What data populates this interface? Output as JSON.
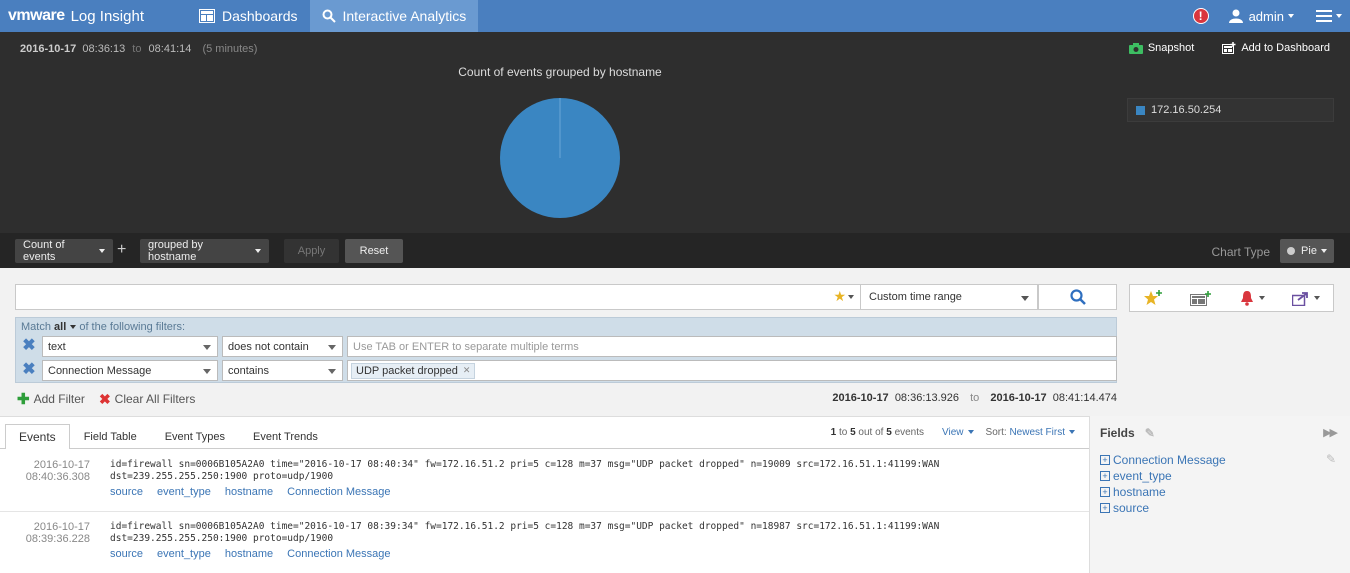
{
  "app": {
    "brand_prefix": "vmware",
    "brand_name": "Log Insight",
    "nav_tabs": [
      {
        "label": "Dashboards",
        "icon": "dashboard-icon"
      },
      {
        "label": "Interactive Analytics",
        "icon": "search-icon"
      }
    ],
    "user": "admin"
  },
  "chart_header": {
    "date": "2016-10-17",
    "start_time": "08:36:13",
    "to_label": "to",
    "end_time": "08:41:14",
    "duration": "(5 minutes)",
    "snapshot_label": "Snapshot",
    "add_to_dashboard_label": "Add to Dashboard"
  },
  "chart_data": {
    "type": "pie",
    "title": "Count of events grouped by hostname",
    "categories": [
      "172.16.50.254"
    ],
    "values": [
      5
    ],
    "legend_placement": "right",
    "colors": [
      "#3a86c2"
    ]
  },
  "query_bar": {
    "count_label": "Count of events",
    "plus_label": "+",
    "group_label": "grouped by hostname",
    "apply_label": "Apply",
    "reset_label": "Reset",
    "chart_type_label": "Chart Type",
    "chart_type_value": "Pie"
  },
  "search": {
    "value": "",
    "time_range": "Custom time range"
  },
  "filters": {
    "match_prefix": "Match",
    "match_value": "all",
    "match_suffix": "of the following filters:",
    "rows": [
      {
        "field": "text",
        "operator": "does not contain",
        "placeholder": "Use TAB or ENTER to separate multiple terms",
        "tags": []
      },
      {
        "field": "Connection Message",
        "operator": "contains",
        "placeholder": "",
        "tags": [
          "UDP packet dropped"
        ]
      }
    ],
    "add_filter_label": "Add Filter",
    "clear_filters_label": "Clear All Filters",
    "range_start_date": "2016-10-17",
    "range_start_time": "08:36:13.926",
    "range_to": "to",
    "range_end_date": "2016-10-17",
    "range_end_time": "08:41:14.474"
  },
  "results": {
    "tabs": [
      "Events",
      "Field Table",
      "Event Types",
      "Event Trends"
    ],
    "page_from": "1",
    "page_to_word": "to",
    "page_to": "5",
    "out_of_word": "out of",
    "total": "5",
    "events_word": "events",
    "view_label": "View",
    "sort_label": "Sort:",
    "sort_value": "Newest First",
    "events": [
      {
        "date": "2016-10-17",
        "time": "08:40:36.308",
        "line1": "id=firewall sn=0006B105A2A0 time=\"2016-10-17 08:40:34\" fw=172.16.51.2 pri=5 c=128 m=37 msg=\"UDP packet dropped\" n=19009 src=172.16.51.1:41199:WAN",
        "line2": "dst=239.255.255.250:1900 proto=udp/1900",
        "fields": [
          "source",
          "event_type",
          "hostname",
          "Connection Message"
        ]
      },
      {
        "date": "2016-10-17",
        "time": "08:39:36.228",
        "line1": "id=firewall sn=0006B105A2A0 time=\"2016-10-17 08:39:34\" fw=172.16.51.2 pri=5 c=128 m=37 msg=\"UDP packet dropped\" n=18987 src=172.16.51.1:41199:WAN",
        "line2": "dst=239.255.255.250:1900 proto=udp/1900",
        "fields": [
          "source",
          "event_type",
          "hostname",
          "Connection Message"
        ]
      }
    ]
  },
  "fields_panel": {
    "title": "Fields",
    "items": [
      "Connection Message",
      "event_type",
      "hostname",
      "source"
    ]
  }
}
